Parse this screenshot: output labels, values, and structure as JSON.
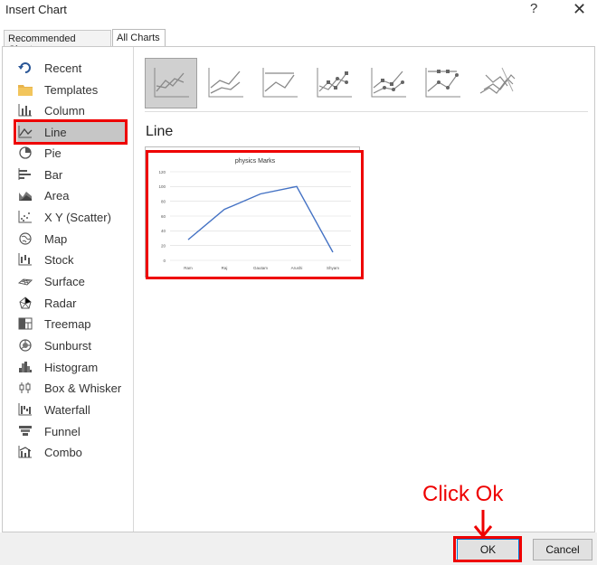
{
  "window": {
    "title": "Insert Chart",
    "help": "?",
    "close": "✕"
  },
  "tabs": [
    {
      "label": "Recommended Charts"
    },
    {
      "label": "All Charts"
    }
  ],
  "categories": [
    {
      "label": "Recent",
      "icon": "recent-icon"
    },
    {
      "label": "Templates",
      "icon": "templates-folder-icon"
    },
    {
      "label": "Column",
      "icon": "column-chart-icon"
    },
    {
      "label": "Line",
      "icon": "line-chart-icon",
      "selected": true
    },
    {
      "label": "Pie",
      "icon": "pie-chart-icon"
    },
    {
      "label": "Bar",
      "icon": "bar-chart-icon"
    },
    {
      "label": "Area",
      "icon": "area-chart-icon"
    },
    {
      "label": "X Y (Scatter)",
      "icon": "scatter-chart-icon"
    },
    {
      "label": "Map",
      "icon": "map-chart-icon"
    },
    {
      "label": "Stock",
      "icon": "stock-chart-icon"
    },
    {
      "label": "Surface",
      "icon": "surface-chart-icon"
    },
    {
      "label": "Radar",
      "icon": "radar-chart-icon"
    },
    {
      "label": "Treemap",
      "icon": "treemap-chart-icon"
    },
    {
      "label": "Sunburst",
      "icon": "sunburst-chart-icon"
    },
    {
      "label": "Histogram",
      "icon": "histogram-chart-icon"
    },
    {
      "label": "Box & Whisker",
      "icon": "box-whisker-chart-icon"
    },
    {
      "label": "Waterfall",
      "icon": "waterfall-chart-icon"
    },
    {
      "label": "Funnel",
      "icon": "funnel-chart-icon"
    },
    {
      "label": "Combo",
      "icon": "combo-chart-icon"
    }
  ],
  "section": {
    "title": "Line"
  },
  "buttons": {
    "ok": "OK",
    "cancel": "Cancel"
  },
  "annotation": {
    "text": "Click Ok"
  },
  "colors": {
    "highlight": "#e00000",
    "series": "#4472c4",
    "selected_bg": "#c6c6c6"
  },
  "chart_data": {
    "type": "line",
    "title": "physics Marks",
    "categories": [
      "Ram",
      "Raj",
      "Gautam",
      "Arushi",
      "Shyam"
    ],
    "series": [
      {
        "values": [
          28,
          69,
          90,
          100,
          11
        ]
      }
    ],
    "yticks": [
      "0",
      "20",
      "40",
      "60",
      "80",
      "100",
      "120"
    ],
    "ylim": [
      0,
      120
    ],
    "grid": true
  }
}
